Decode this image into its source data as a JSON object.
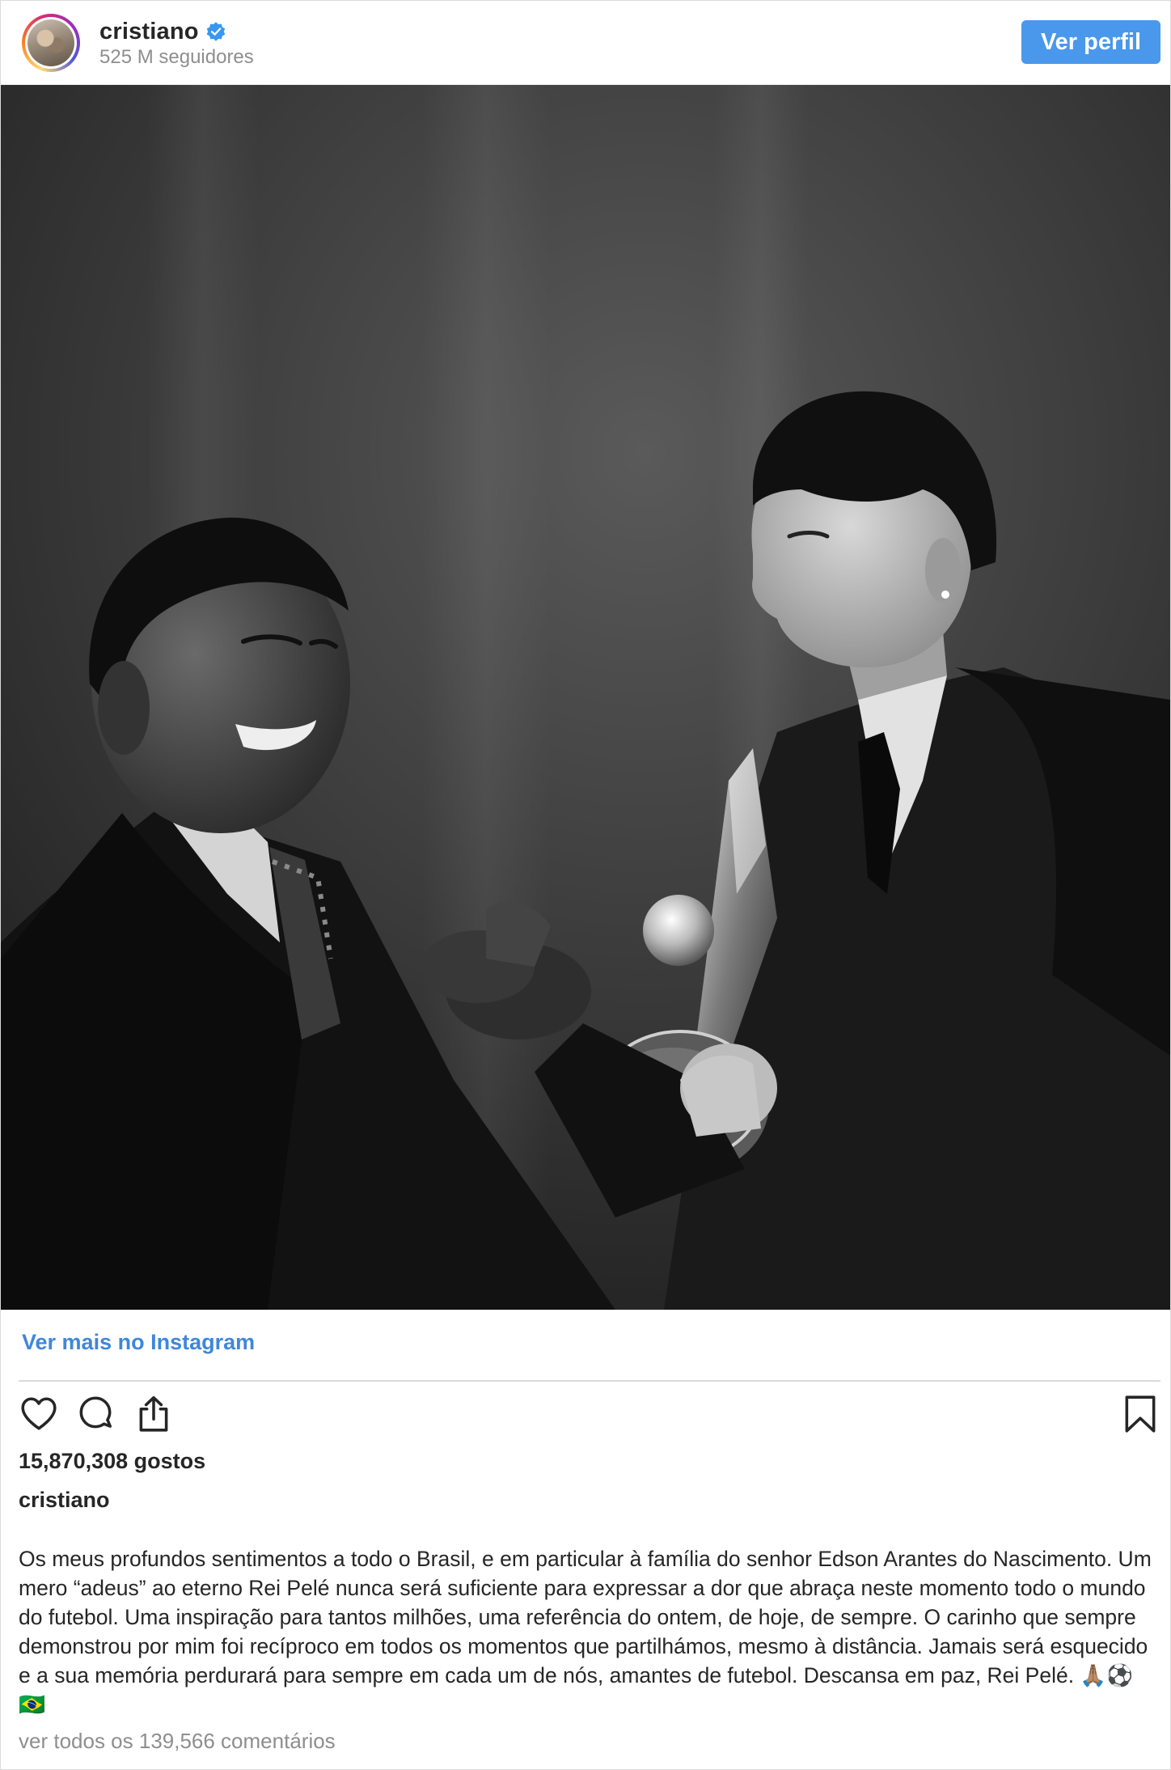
{
  "header": {
    "username": "cristiano",
    "followers": "525 M seguidores",
    "view_profile_label": "Ver perfil"
  },
  "post": {
    "image_alt": "Foto a preto e branco: Pelé aperta a mão de Cristiano Ronaldo, que segura um troféu",
    "more_link_label": "Ver mais no Instagram",
    "likes": "15,870,308 gostos",
    "caption_user": "cristiano",
    "caption_text": "Os meus profundos sentimentos a todo o Brasil, e em particular à família do senhor Edson Arantes do Nascimento. Um mero “adeus” ao eterno Rei Pelé nunca será suficiente para expressar a dor que abraça neste momento todo o mundo do futebol. Uma inspiração para tantos milhões, uma referência do ontem, de hoje, de sempre. O carinho que sempre demonstrou por mim foi recíproco em todos os momentos que partilhámos, mesmo à distância. Jamais será esquecido e a sua memória perdurará para sempre em cada um de nós, amantes de futebol. Descansa em paz, Rei Pelé. 🙏🏽⚽️🇧🇷",
    "comments_link": "ver todos os 139,566 comentários"
  },
  "icons": {
    "verified": "verified-badge-icon",
    "like": "heart-icon",
    "comment": "comment-bubble-icon",
    "share": "share-upload-icon",
    "save": "bookmark-icon"
  },
  "colors": {
    "accent_blue": "#4a98ec",
    "link_blue": "#3f87d9",
    "text_primary": "#262626",
    "text_secondary": "#8e8e8e",
    "verified_blue": "#3897f0"
  }
}
